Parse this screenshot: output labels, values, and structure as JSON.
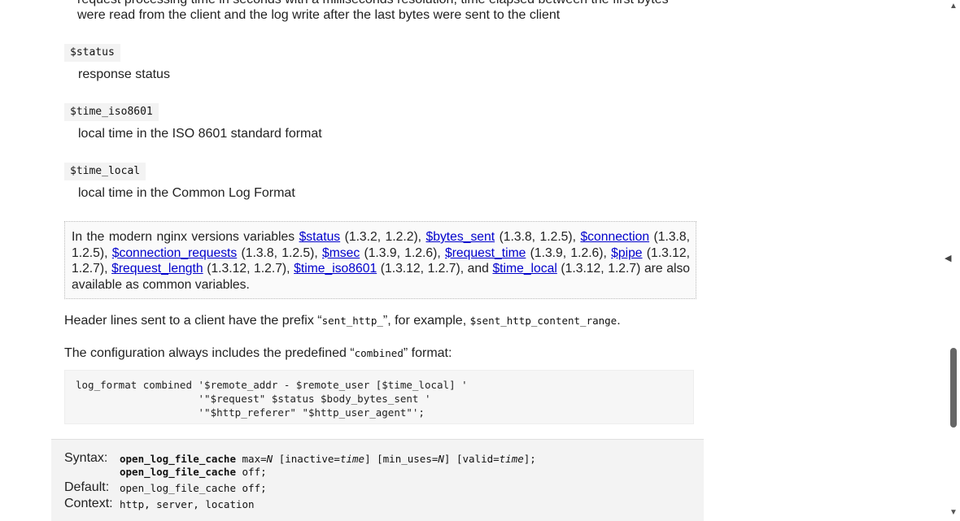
{
  "top_clip_text": "request processing time in seconds with a milliseconds resolution; time elapsed between the first bytes",
  "top_line": "were read from the client and the log write after the last bytes were sent to the client",
  "vars": [
    {
      "name": "$status",
      "desc": "response status"
    },
    {
      "name": "$time_iso8601",
      "desc": "local time in the ISO 8601 standard format"
    },
    {
      "name": "$time_local",
      "desc": "local time in the Common Log Format"
    }
  ],
  "note": {
    "t1": "In the modern nginx versions variables ",
    "l1": "$status",
    "t2": " (1.3.2, 1.2.2), ",
    "l2": "$bytes_sent",
    "t3": " (1.3.8, 1.2.5), ",
    "l3": "$connection",
    "t4": " (1.3.8, 1.2.5), ",
    "l4": "$connection_requests",
    "t5": " (1.3.8, 1.2.5), ",
    "l5": "$msec",
    "t6": " (1.3.9, 1.2.6), ",
    "l6": "$request_time",
    "t7": " (1.3.9, 1.2.6), ",
    "l7": "$pipe",
    "t8": " (1.3.12, 1.2.7), ",
    "l8": "$request_length",
    "t9": " (1.3.12, 1.2.7), ",
    "l9": "$time_iso8601",
    "t10": " (1.3.12, 1.2.7), and ",
    "l10": "$time_local",
    "t11": " (1.3.12, 1.2.7) are also available as common variables."
  },
  "header_para": {
    "before": "Header lines sent to a client have the prefix “",
    "code1": "sent_http_",
    "middle": "”, for example, ",
    "code2": "$sent_http_content_range",
    "after": "."
  },
  "config_para": {
    "before": "The configuration always includes the predefined “",
    "code": "combined",
    "after": "” format:"
  },
  "pre_lines": [
    "log_format combined '$remote_addr - $remote_user [$time_local] '",
    "                    '\"$request\" $status $body_bytes_sent '",
    "                    '\"$http_referer\" \"$http_user_agent\"';"
  ],
  "directive": {
    "syntax_label": "Syntax:",
    "syntax_l1_name": "open_log_file_cache",
    "syntax_l1_rest1": " max=",
    "syntax_l1_N": "N",
    "syntax_l1_rest2": " [inactive=",
    "syntax_l1_time1": "time",
    "syntax_l1_rest3": "] [min_uses=",
    "syntax_l1_N2": "N",
    "syntax_l1_rest4": "] [valid=",
    "syntax_l1_time2": "time",
    "syntax_l1_rest5": "];",
    "syntax_l2_name": "open_log_file_cache",
    "syntax_l2_rest": " off;",
    "default_label": "Default:",
    "default_value": "open_log_file_cache off;",
    "context_label": "Context:",
    "context_value": "http, server, location"
  }
}
